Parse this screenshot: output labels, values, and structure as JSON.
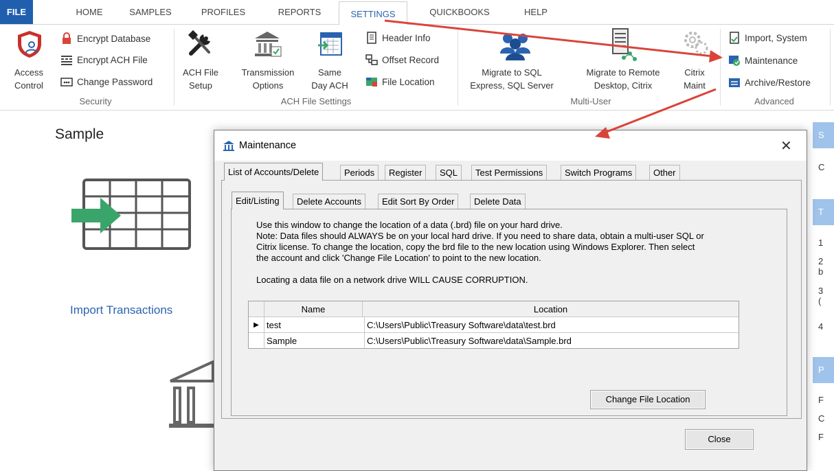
{
  "ribbon_tabs": {
    "file": "FILE",
    "home": "HOME",
    "samples": "SAMPLES",
    "profiles": "PROFILES",
    "reports": "REPORTS",
    "settings": "SETTINGS",
    "quickbooks": "QUICKBOOKS",
    "help": "HELP"
  },
  "security": {
    "access_control_l1": "Access",
    "access_control_l2": "Control",
    "encrypt_database": "Encrypt Database",
    "encrypt_ach_file": "Encrypt ACH File",
    "change_password": "Change Password",
    "group_label": "Security"
  },
  "ach_settings": {
    "ach_file_setup_l1": "ACH File",
    "ach_file_setup_l2": "Setup",
    "transmission_l1": "Transmission",
    "transmission_l2": "Options",
    "same_day_l1": "Same",
    "same_day_l2": "Day ACH",
    "header_info": "Header Info",
    "offset_record": "Offset Record",
    "file_location": "File Location",
    "group_label": "ACH File Settings"
  },
  "multi_user": {
    "migrate_sql_l1": "Migrate to SQL",
    "migrate_sql_l2": "Express, SQL Server",
    "migrate_remote_l1": "Migrate to Remote",
    "migrate_remote_l2": "Desktop, Citrix",
    "citrix_l1": "Citrix",
    "citrix_l2": "Maint",
    "group_label": "Multi-User"
  },
  "advanced": {
    "import_system": "Import, System",
    "maintenance": "Maintenance",
    "archive_restore": "Archive/Restore",
    "group_label": "Advanced"
  },
  "sample": {
    "heading": "Sample",
    "import_transactions": "Import Transactions"
  },
  "side_chars": [
    "S",
    "C",
    "T",
    "1",
    "2",
    "b",
    "3",
    "(",
    "4",
    "P",
    "F",
    "C",
    "F"
  ],
  "dialog": {
    "title": "Maintenance",
    "close_x": "✕",
    "tabs": [
      "List of Accounts/Delete",
      "Periods",
      "Register",
      "SQL",
      "Test Permissions",
      "Switch Programs",
      "Other"
    ],
    "subtabs": [
      "Edit/Listing",
      "Delete Accounts",
      "Edit Sort By Order",
      "Delete Data"
    ],
    "note_l1": "Use this window to change the location of a data (.brd) file on your hard drive.",
    "note_l2": "Note: Data files should ALWAYS be on your local hard drive.  If you need to share data, obtain a multi-user SQL or",
    "note_l3": "Citrix license. To change the location, copy the brd file to the new location using Windows Explorer.  Then select",
    "note_l4": "the account and click 'Change File Location' to point to the new location.",
    "warning": "Locating a data file on a network drive WILL CAUSE CORRUPTION.",
    "grid": {
      "columns": [
        "Name",
        "Location"
      ],
      "rows": [
        {
          "selector": "▶",
          "name": "test",
          "location": "C:\\Users\\Public\\Treasury Software\\data\\test.brd"
        },
        {
          "selector": "",
          "name": "Sample",
          "location": "C:\\Users\\Public\\Treasury Software\\data\\Sample.brd"
        }
      ]
    },
    "change_file_location": "Change File Location",
    "close": "Close"
  },
  "colors": {
    "file_tab": "#1f5fad",
    "accent": "#2a63b0",
    "annotation_arrow": "#d9443a",
    "side_header": "#9fc3ea",
    "green_arrow": "#3aa56a"
  }
}
